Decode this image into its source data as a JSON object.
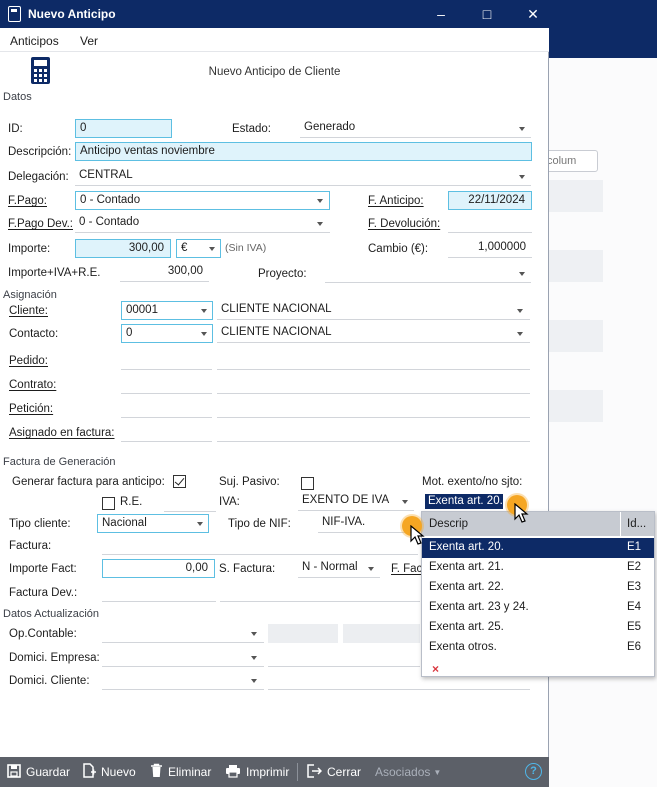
{
  "window": {
    "title": "Nuevo Anticipo"
  },
  "menu": {
    "items": [
      "Anticipos",
      "Ver"
    ]
  },
  "page_title": "Nuevo Anticipo de Cliente",
  "background": {
    "search_text": "colum"
  },
  "sections": {
    "datos": "Datos",
    "asignacion": "Asignación",
    "factura": "Factura de Generación",
    "actualizacion": "Datos Actualización"
  },
  "form": {
    "id_label": "ID:",
    "id_value": "0",
    "estado_label": "Estado:",
    "estado_value": "Generado",
    "descripcion_label": "Descripción:",
    "descripcion_value": "Anticipo ventas noviembre",
    "delegacion_label": "Delegación:",
    "delegacion_value": "CENTRAL",
    "fpago_label": "F.Pago:",
    "fpago_value": "0 - Contado",
    "fanticipo_label": "F. Anticipo:",
    "fanticipo_value": "22/11/2024",
    "fpagodev_label": "F.Pago Dev.:",
    "fpagodev_value": "0 - Contado",
    "fdevolucion_label": "F. Devolución:",
    "importe_label": "Importe:",
    "importe_value": "300,00",
    "moneda_value": "€",
    "siniva_label": "(Sin IVA)",
    "cambio_label": "Cambio (€):",
    "cambio_value": "1,000000",
    "importe_iva_label": "Importe+IVA+R.E.",
    "importe_iva_value": "300,00",
    "proyecto_label": "Proyecto:"
  },
  "asignacion": {
    "cliente_label": "Cliente:",
    "cliente_code": "00001",
    "cliente_name": "CLIENTE NACIONAL",
    "contacto_label": "Contacto:",
    "contacto_code": "0",
    "contacto_name": "CLIENTE NACIONAL",
    "pedido_label": "Pedido:",
    "contrato_label": "Contrato:",
    "peticion_label": "Petición:",
    "asignado_label": "Asignado en factura:"
  },
  "factura": {
    "generar_label": "Generar factura para anticipo:",
    "generar_checked": true,
    "sujpasivo_label": "Suj. Pasivo:",
    "sujpasivo_checked": false,
    "motexento_label": "Mot. exento/no sjto:",
    "motexento_value": "Exenta art. 20.",
    "re_label": "R.E.",
    "re_checked": false,
    "iva_label": "IVA:",
    "iva_value": "EXENTO DE IVA",
    "tipocliente_label": "Tipo cliente:",
    "tipocliente_value": "Nacional",
    "tiponif_label": "Tipo de NIF:",
    "tiponif_value": "NIF-IVA.",
    "factura_label": "Factura:",
    "importefact_label": "Importe Fact:",
    "importefact_value": "0,00",
    "sfactura_label": "S. Factura:",
    "sfactura_value": "N - Normal",
    "ffac_label": "F. Fac",
    "facturadev_label": "Factura Dev.:"
  },
  "actualizacion": {
    "opcontable_label": "Op.Contable:",
    "domempresa_label": "Domici. Empresa:",
    "domcliente_label": "Domici. Cliente:"
  },
  "popup": {
    "col_descrip": "Descrip",
    "col_id": "Id...",
    "rows": [
      {
        "descrip": "Exenta art. 20.",
        "id": "E1",
        "selected": true
      },
      {
        "descrip": "Exenta art. 21.",
        "id": "E2"
      },
      {
        "descrip": "Exenta art. 22.",
        "id": "E3"
      },
      {
        "descrip": "Exenta art. 23 y 24.",
        "id": "E4"
      },
      {
        "descrip": "Exenta art. 25.",
        "id": "E5"
      },
      {
        "descrip": "Exenta otros.",
        "id": "E6"
      }
    ],
    "clear_symbol": "×"
  },
  "toolbar": {
    "guardar": "Guardar",
    "nuevo": "Nuevo",
    "eliminar": "Eliminar",
    "imprimir": "Imprimir",
    "cerrar": "Cerrar",
    "asociados": "Asociados",
    "help": "?"
  },
  "colors": {
    "titlebar": "#0d2a66",
    "field_border": "#5dbfe2",
    "field_fill": "#dff3fb",
    "toolbar": "#5c6068",
    "cursor_dot": "#f5a623"
  }
}
